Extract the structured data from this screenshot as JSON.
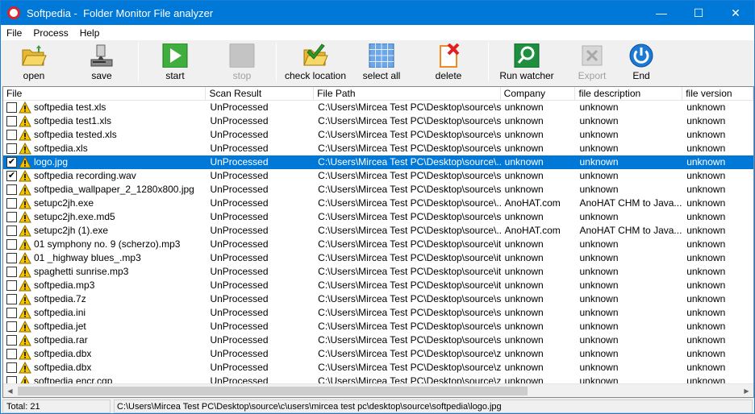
{
  "window": {
    "title": "Softpedia -  Folder Monitor File analyzer",
    "controls": {
      "minimize": "—",
      "maximize": "☐",
      "close": "✕"
    }
  },
  "menu": [
    {
      "label": "File"
    },
    {
      "label": "Process"
    },
    {
      "label": "Help"
    }
  ],
  "toolbar": {
    "open": "open",
    "save": "save",
    "start": "start",
    "stop": "stop",
    "check_location": "check location",
    "select_all": "select all",
    "delete": "delete",
    "run_watcher": "Run watcher",
    "export": "Export",
    "end": "End"
  },
  "columns": [
    "File",
    "Scan Result",
    "File Path",
    "Company",
    "file description",
    "file version"
  ],
  "rows": [
    {
      "checked": false,
      "selected": false,
      "file": "softpedia test.xls",
      "scan": "UnProcessed",
      "path": "C:\\Users\\Mircea Test PC\\Desktop\\source\\s...",
      "company": "unknown",
      "desc": "unknown",
      "version": "unknown"
    },
    {
      "checked": false,
      "selected": false,
      "file": "softpedia test1.xls",
      "scan": "UnProcessed",
      "path": "C:\\Users\\Mircea Test PC\\Desktop\\source\\s...",
      "company": "unknown",
      "desc": "unknown",
      "version": "unknown"
    },
    {
      "checked": false,
      "selected": false,
      "file": "softpedia tested.xls",
      "scan": "UnProcessed",
      "path": "C:\\Users\\Mircea Test PC\\Desktop\\source\\s...",
      "company": "unknown",
      "desc": "unknown",
      "version": "unknown"
    },
    {
      "checked": false,
      "selected": false,
      "file": "softpedia.xls",
      "scan": "UnProcessed",
      "path": "C:\\Users\\Mircea Test PC\\Desktop\\source\\s...",
      "company": "unknown",
      "desc": "unknown",
      "version": "unknown"
    },
    {
      "checked": true,
      "selected": true,
      "file": "logo.jpg",
      "scan": "UnProcessed",
      "path": "C:\\Users\\Mircea Test PC\\Desktop\\source\\...",
      "company": "unknown",
      "desc": "unknown",
      "version": "unknown"
    },
    {
      "checked": true,
      "selected": false,
      "file": "softpedia recording.wav",
      "scan": "UnProcessed",
      "path": "C:\\Users\\Mircea Test PC\\Desktop\\source\\s...",
      "company": "unknown",
      "desc": "unknown",
      "version": "unknown"
    },
    {
      "checked": false,
      "selected": false,
      "file": "softpedia_wallpaper_2_1280x800.jpg",
      "scan": "UnProcessed",
      "path": "C:\\Users\\Mircea Test PC\\Desktop\\source\\s...",
      "company": "unknown",
      "desc": "unknown",
      "version": "unknown"
    },
    {
      "checked": false,
      "selected": false,
      "file": "setupc2jh.exe",
      "scan": "UnProcessed",
      "path": "C:\\Users\\Mircea Test PC\\Desktop\\source\\...",
      "company": "AnoHAT.com",
      "desc": "AnoHAT CHM to Java...",
      "version": "unknown"
    },
    {
      "checked": false,
      "selected": false,
      "file": "setupc2jh.exe.md5",
      "scan": "UnProcessed",
      "path": "C:\\Users\\Mircea Test PC\\Desktop\\source\\s...",
      "company": "unknown",
      "desc": "unknown",
      "version": "unknown"
    },
    {
      "checked": false,
      "selected": false,
      "file": "setupc2jh (1).exe",
      "scan": "UnProcessed",
      "path": "C:\\Users\\Mircea Test PC\\Desktop\\source\\...",
      "company": "AnoHAT.com",
      "desc": "AnoHAT CHM to Java...",
      "version": "unknown"
    },
    {
      "checked": false,
      "selected": false,
      "file": "01 symphony no. 9 (scherzo).mp3",
      "scan": "UnProcessed",
      "path": "C:\\Users\\Mircea Test PC\\Desktop\\source\\it...",
      "company": "unknown",
      "desc": "unknown",
      "version": "unknown"
    },
    {
      "checked": false,
      "selected": false,
      "file": "01 _highway blues_.mp3",
      "scan": "UnProcessed",
      "path": "C:\\Users\\Mircea Test PC\\Desktop\\source\\it...",
      "company": "unknown",
      "desc": "unknown",
      "version": "unknown"
    },
    {
      "checked": false,
      "selected": false,
      "file": "spaghetti sunrise.mp3",
      "scan": "UnProcessed",
      "path": "C:\\Users\\Mircea Test PC\\Desktop\\source\\it...",
      "company": "unknown",
      "desc": "unknown",
      "version": "unknown"
    },
    {
      "checked": false,
      "selected": false,
      "file": "softpedia.mp3",
      "scan": "UnProcessed",
      "path": "C:\\Users\\Mircea Test PC\\Desktop\\source\\it...",
      "company": "unknown",
      "desc": "unknown",
      "version": "unknown"
    },
    {
      "checked": false,
      "selected": false,
      "file": "softpedia.7z",
      "scan": "UnProcessed",
      "path": "C:\\Users\\Mircea Test PC\\Desktop\\source\\s...",
      "company": "unknown",
      "desc": "unknown",
      "version": "unknown"
    },
    {
      "checked": false,
      "selected": false,
      "file": "softpedia.ini",
      "scan": "UnProcessed",
      "path": "C:\\Users\\Mircea Test PC\\Desktop\\source\\s...",
      "company": "unknown",
      "desc": "unknown",
      "version": "unknown"
    },
    {
      "checked": false,
      "selected": false,
      "file": "softpedia.jet",
      "scan": "UnProcessed",
      "path": "C:\\Users\\Mircea Test PC\\Desktop\\source\\s...",
      "company": "unknown",
      "desc": "unknown",
      "version": "unknown"
    },
    {
      "checked": false,
      "selected": false,
      "file": "softpedia.rar",
      "scan": "UnProcessed",
      "path": "C:\\Users\\Mircea Test PC\\Desktop\\source\\s...",
      "company": "unknown",
      "desc": "unknown",
      "version": "unknown"
    },
    {
      "checked": false,
      "selected": false,
      "file": "softpedia.dbx",
      "scan": "UnProcessed",
      "path": "C:\\Users\\Mircea Test PC\\Desktop\\source\\z...",
      "company": "unknown",
      "desc": "unknown",
      "version": "unknown"
    },
    {
      "checked": false,
      "selected": false,
      "file": "softpedia.dbx",
      "scan": "UnProcessed",
      "path": "C:\\Users\\Mircea Test PC\\Desktop\\source\\z...",
      "company": "unknown",
      "desc": "unknown",
      "version": "unknown"
    },
    {
      "checked": false,
      "selected": false,
      "file": "softpedia encr.cgp",
      "scan": "UnProcessed",
      "path": "C:\\Users\\Mircea Test PC\\Desktop\\source\\z...",
      "company": "unknown",
      "desc": "unknown",
      "version": "unknown"
    }
  ],
  "status": {
    "total": "Total: 21",
    "path": "C:\\Users\\Mircea Test PC\\Desktop\\source\\c\\users\\mircea test pc\\desktop\\source\\softpedia\\logo.jpg"
  },
  "colors": {
    "titlebar": "#0078d7",
    "selection": "#0078d7",
    "warning": "#f5c400"
  }
}
